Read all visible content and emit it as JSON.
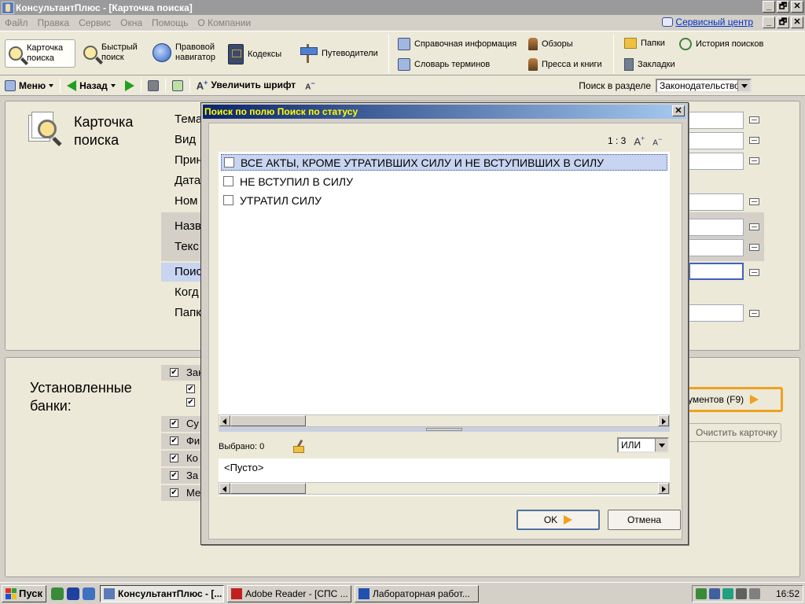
{
  "window": {
    "title": "КонсультантПлюс - [Карточка поиска]",
    "buttons": [
      "_",
      "🗗",
      "✕"
    ]
  },
  "menu": {
    "items": [
      "Файл",
      "Правка",
      "Сервис",
      "Окна",
      "Помощь",
      "О Компании"
    ],
    "service_center": "Сервисный центр"
  },
  "ribbon": {
    "search_card": "Карточка поиска",
    "quick_search": "Быстрый поиск",
    "legal_navigator": "Правовой навигатор",
    "codes": "Кодексы",
    "guides": "Путеводители",
    "reference_info": "Справочная информация",
    "glossary": "Словарь терминов",
    "reviews": "Обзоры",
    "press_books": "Пресса и книги",
    "folders": "Папки",
    "search_history": "История поисков",
    "bookmarks": "Закладки"
  },
  "toolbar": {
    "menu": "Меню",
    "back": "Назад",
    "enlarge_font": "Увеличить шрифт",
    "search_in_section_label": "Поиск в разделе",
    "section_value": "Законодательство"
  },
  "card": {
    "title_line1": "Карточка",
    "title_line2": "поиска",
    "fields": [
      "Тема",
      "Вид",
      "Прин",
      "Дата",
      "Ном",
      "Назв",
      "Текс",
      "Поис",
      "Когд",
      "Папк"
    ]
  },
  "banks": {
    "title_line1": "Установленные",
    "title_line2": "банки:",
    "rows": [
      "Зак",
      "Су",
      "Фи",
      "Ко",
      "За",
      "Ме"
    ],
    "build_list_button": "ументов (F9)",
    "clear_card_button": "Очистить карточку"
  },
  "dialog": {
    "title": "Поиск по полю Поиск по статусу",
    "counter": "1 : 3",
    "items": [
      "ВСЕ АКТЫ, КРОМЕ УТРАТИВШИХ СИЛУ И НЕ ВСТУПИВШИХ В СИЛУ",
      "НЕ ВСТУПИЛ В СИЛУ",
      "УТРАТИЛ СИЛУ"
    ],
    "selected_label": "Выбрано: 0",
    "logic_value": "ИЛИ",
    "empty_text": "<Пусто>",
    "ok": "OK",
    "cancel": "Отмена"
  },
  "taskbar": {
    "start": "Пуск",
    "tasks": [
      "КонсультантПлюс - [...",
      "Adobe Reader - [СПС ...",
      "Лабораторная работ..."
    ],
    "time": "16:52"
  }
}
